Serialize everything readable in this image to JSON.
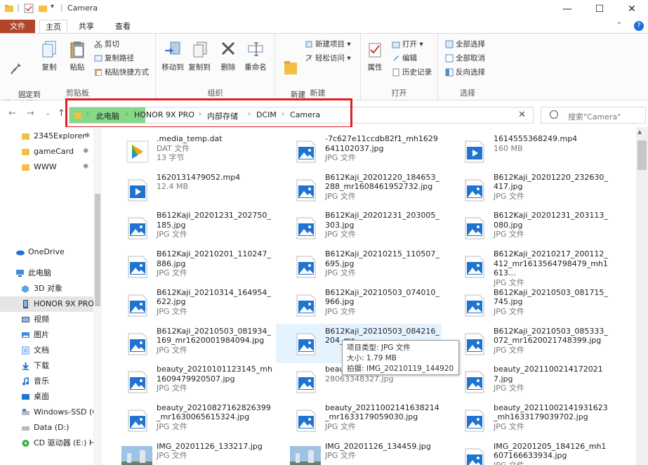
{
  "window": {
    "title": "Camera",
    "minimize": "—",
    "maximize": "☐",
    "close": "✕"
  },
  "ribbon_tabs": {
    "file": "文件",
    "home": "主页",
    "share": "共享",
    "view": "查看"
  },
  "ribbon": {
    "clipboard": {
      "label": "剪贴板",
      "pin": "固定到\n快速访问",
      "copy": "复制",
      "paste": "粘贴",
      "cut": "剪切",
      "copy_path": "复制路径",
      "paste_shortcut": "粘贴快捷方式"
    },
    "organize": {
      "label": "组织",
      "move_to": "移动到",
      "copy_to": "复制到",
      "delete": "删除",
      "rename": "重命名"
    },
    "new": {
      "label": "新建",
      "new_folder": "新建\n文件夹",
      "new_item": "新建项目 ▾",
      "easy_access": "轻松访问 ▾"
    },
    "open": {
      "label": "打开",
      "properties": "属性",
      "open": "打开 ▾",
      "edit": "编辑",
      "history": "历史记录"
    },
    "select": {
      "label": "选择",
      "select_all": "全部选择",
      "select_none": "全部取消",
      "invert": "反向选择"
    }
  },
  "address": {
    "segments": [
      "此电脑",
      "HONOR 9X PRO",
      "内部存储",
      "DCIM",
      "Camera"
    ],
    "search_placeholder": "搜索\"Camera\"",
    "highlight_color": "#84d888",
    "redbox_color": "#e01e24"
  },
  "nav": {
    "quick": [
      {
        "label": "2345Explorer",
        "pin": "✱"
      },
      {
        "label": "gameCard",
        "pin": "✱"
      },
      {
        "label": "WWW",
        "pin": "✱"
      }
    ],
    "onedrive": "OneDrive",
    "thispc": "此电脑",
    "items": [
      "3D 对象",
      "HONOR 9X PRO",
      "视频",
      "图片",
      "文档",
      "下载",
      "音乐",
      "桌面",
      "Windows-SSD (C:)",
      "Data (D:)",
      "CD 驱动器 (E:) H"
    ]
  },
  "files": [
    {
      "name": ".media_temp.dat",
      "type": "DAT 文件",
      "extra": "13 字节",
      "icon": "dat-icon"
    },
    {
      "name": "-7c627e11ccdb82f1_mh1629641102037.jpg",
      "type": "JPG 文件",
      "icon": "image-icon"
    },
    {
      "name": "1614555368249.mp4",
      "type": "160 MB",
      "icon": "video-icon"
    },
    {
      "name": "1620131479052.mp4",
      "type": "12.4 MB",
      "icon": "video-icon"
    },
    {
      "name": "B612Kaji_20201220_184653_288_mr1608461952732.jpg",
      "type": "JPG 文件",
      "icon": "image-icon"
    },
    {
      "name": "B612Kaji_20201220_232630_417.jpg",
      "type": "JPG 文件",
      "icon": "image-icon"
    },
    {
      "name": "B612Kaji_20201231_202750_185.jpg",
      "type": "JPG 文件",
      "icon": "image-icon"
    },
    {
      "name": "B612Kaji_20201231_203005_303.jpg",
      "type": "JPG 文件",
      "icon": "image-icon"
    },
    {
      "name": "B612Kaji_20201231_203113_080.jpg",
      "type": "JPG 文件",
      "icon": "image-icon"
    },
    {
      "name": "B612Kaji_20210201_110247_886.jpg",
      "type": "JPG 文件",
      "icon": "image-icon"
    },
    {
      "name": "B612Kaji_20210215_110507_695.jpg",
      "type": "JPG 文件",
      "icon": "image-icon"
    },
    {
      "name": "B612Kaji_20210217_200112_412_mr1613564798479_mh1613...",
      "type": "JPG 文件",
      "icon": "image-icon"
    },
    {
      "name": "B612Kaji_20210314_164954_622.jpg",
      "type": "JPG 文件",
      "icon": "image-icon"
    },
    {
      "name": "B612Kaji_20210503_074010_966.jpg",
      "type": "JPG 文件",
      "icon": "image-icon"
    },
    {
      "name": "B612Kaji_20210503_081715_745.jpg",
      "type": "JPG 文件",
      "icon": "image-icon"
    },
    {
      "name": "B612Kaji_20210503_081934_169_mr1620001984094.jpg",
      "type": "JPG 文件",
      "icon": "image-icon"
    },
    {
      "name": "B612Kaji_20210503_084216_204_mr",
      "type": "",
      "icon": "image-icon"
    },
    {
      "name": "B612Kaji_20210503_085333_072_mr1620021748399.jpg",
      "type": "JPG 文件",
      "icon": "image-icon"
    },
    {
      "name": "beauty_20210101123145_mh1609479920507.jpg",
      "type": "JPG 文件",
      "icon": "image-icon"
    },
    {
      "name": "beaut",
      "type": "28063348327.jpg",
      "icon": "image-icon"
    },
    {
      "name": "beauty_20211002141720217.jpg",
      "type": "JPG 文件",
      "icon": "image-icon"
    },
    {
      "name": "beauty_20210827162826399_mr1630065615324.jpg",
      "type": "JPG 文件",
      "icon": "image-icon"
    },
    {
      "name": "beauty_20211002141638214_mr1633179059030.jpg",
      "type": "JPG 文件",
      "icon": "image-icon"
    },
    {
      "name": "beauty_20211002141931623_mh1633179039702.jpg",
      "type": "JPG 文件",
      "icon": "image-icon"
    },
    {
      "name": "IMG_20201126_133217.jpg",
      "type": "JPG 文件",
      "icon": "photo-thumb"
    },
    {
      "name": "IMG_20201126_134459.jpg",
      "type": "JPG 文件",
      "icon": "photo-thumb"
    },
    {
      "name": "IMG_20201205_184126_mh1607166633934.jpg",
      "type": "JPG 文件",
      "icon": "image-icon"
    }
  ],
  "tooltip": {
    "line1": "项目类型: JPG 文件",
    "line2": "大小: 1.79 MB",
    "line3": "拍摄: IMG_20210119_144920"
  }
}
